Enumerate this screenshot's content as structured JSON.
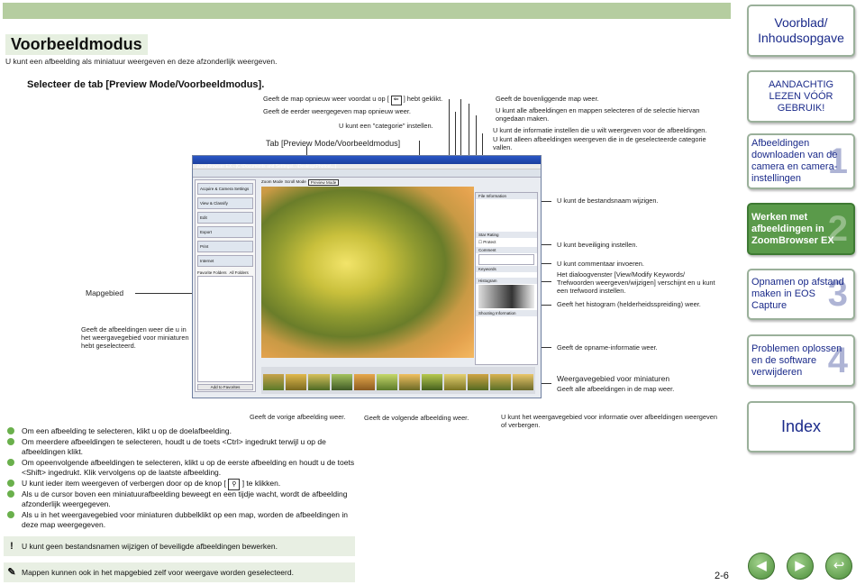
{
  "header": {
    "title": "Voorbeeldmodus",
    "subtitle": "U kunt een afbeelding als miniatuur weergeven en deze afzonderlijk weergeven.",
    "step": "Selecteer de tab [Preview Mode/Voorbeeldmodus]."
  },
  "captions": {
    "c1": "Geeft de map opnieuw weer voordat u op [",
    "c1b": "] hebt geklikt.",
    "c2": "Geeft de eerder weergegeven map opnieuw weer.",
    "c3": "U kunt een \"categorie\" instellen.",
    "c4": "Tab [Preview Mode/Voorbeeldmodus]",
    "c5": "Geeft de bovenliggende map weer.",
    "c6": "U kunt alle afbeeldingen en mappen selecteren of de selectie hiervan ongedaan maken.",
    "c7": "U kunt de informatie instellen die u wilt weergeven voor de afbeeldingen.",
    "c8": "U kunt alleen afbeeldingen weergeven die in de geselecteerde categorie vallen.",
    "c9": "U kunt de bestandsnaam wijzigen.",
    "c10": "U kunt beveiliging instellen.",
    "c11": "U kunt commentaar invoeren.",
    "c12": "Het dialoogvenster [View/Modify Keywords/ Trefwoorden weergeven/wijzigen] verschijnt en u kunt een trefwoord instellen.",
    "c13": "Geeft het histogram (helderheidsspreiding) weer.",
    "c14": "Geeft de opname-informatie weer.",
    "c15": "Weergavegebied voor miniaturen",
    "c16": "Geeft alle afbeeldingen in de map weer.",
    "c17": "Mapgebied",
    "c18": "Geeft de afbeeldingen weer die u in het weergavegebied voor miniaturen hebt geselecteerd.",
    "c19": "Geeft de vorige afbeelding weer.",
    "c20": "Geeft de volgende afbeelding weer.",
    "c21": "U kunt het weergavegebied voor informatie over afbeeldingen weergeven of verbergen."
  },
  "bullets": [
    "Om een afbeelding te selecteren, klikt u op de doelafbeelding.",
    "Om meerdere afbeeldingen te selecteren, houdt u de toets <Ctrl> ingedrukt terwijl u op de afbeeldingen klikt.",
    "Om opeenvolgende afbeeldingen te selecteren, klikt u op de eerste afbeelding en houdt u de toets <Shift> ingedrukt. Klik vervolgens op de laatste afbeelding.",
    "U kunt ieder item weergeven of verbergen door op de knop [",
    "] te klikken.",
    "Als u de cursor boven een miniatuurafbeelding beweegt en een tijdje wacht, wordt de afbeelding afzonderlijk weergegeven.",
    "Als u in het weergavegebied voor miniaturen dubbelklikt op een map, worden de afbeeldingen in deze map weergegeven."
  ],
  "notes": {
    "warning": "U kunt geen bestandsnamen wijzigen of beveiligde afbeeldingen bewerken.",
    "memo": "Mappen kunnen ook in het mapgebied zelf voor weergave worden geselecteerd."
  },
  "sidebar": {
    "home": "Voorblad/ Inhoudsopgave",
    "caution": "AANDACHTIG LEZEN VÓÓR GEBRUIK!",
    "ch1": "Afbeeldingen downloaden van de camera en camera-instellingen",
    "ch2": "Werken met afbeeldingen in ZoomBrowser EX",
    "ch3": "Opnamen op afstand maken in EOS Capture",
    "ch4": "Problemen oplossen en de software verwijderen",
    "index": "Index",
    "n1": "1",
    "n2": "2",
    "n3": "3",
    "n4": "4"
  },
  "page_number": "2-6",
  "nav": {
    "prev": "◀",
    "next": "▶",
    "back": "↩"
  },
  "shot": {
    "title": "ZoomBrowser EX - [C:\\Documents and Settings\\...\\Desktop\\Photos\\...]",
    "tab": "Preview Mode",
    "tab2": "Zoom Mode",
    "tab3": "Scroll Mode",
    "task1": "Acquire & Camera Settings",
    "task2": "View & Classify",
    "task3": "Edit",
    "task4": "Export",
    "task5": "Print",
    "task6": "Internet",
    "folders": "Favorite Folders",
    "allfolders": "All Folders",
    "infohead": "File Information",
    "rating": "Star Rating",
    "comment": "Comment",
    "keywords": "Keywords",
    "histogram": "Histogram",
    "shooting": "Shooting Information",
    "add": "Add to Favorites",
    "protect": "Protect"
  },
  "colors": {
    "accent": "#b5cda0",
    "bullet": "#6ab04c",
    "sidebar_active": "#5a9a4a",
    "link": "#1a2a8a"
  }
}
